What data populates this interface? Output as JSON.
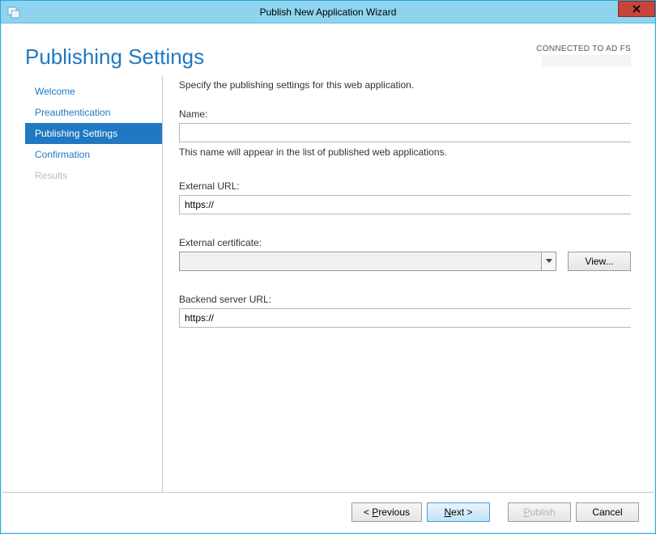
{
  "window": {
    "title": "Publish New Application Wizard"
  },
  "header": {
    "page_title": "Publishing Settings",
    "connected_label": "CONNECTED TO AD FS",
    "connected_host": ""
  },
  "sidebar": {
    "items": [
      {
        "label": "Welcome",
        "state": "link"
      },
      {
        "label": "Preauthentication",
        "state": "link"
      },
      {
        "label": "Publishing Settings",
        "state": "active"
      },
      {
        "label": "Confirmation",
        "state": "link"
      },
      {
        "label": "Results",
        "state": "disabled"
      }
    ]
  },
  "main": {
    "instruction": "Specify the publishing settings for this web application.",
    "name_label": "Name:",
    "name_value": "",
    "name_hint": "This name will appear in the list of published web applications.",
    "external_url_label": "External URL:",
    "external_url_value": "https://",
    "external_cert_label": "External certificate:",
    "external_cert_value": "",
    "view_button": "View...",
    "backend_url_label": "Backend server URL:",
    "backend_url_value": "https://"
  },
  "buttons": {
    "previous_prefix": "< ",
    "previous_letter": "P",
    "previous_rest": "revious",
    "next_letter": "N",
    "next_rest": "ext >",
    "publish_letter": "P",
    "publish_rest": "ublish",
    "cancel": "Cancel"
  }
}
